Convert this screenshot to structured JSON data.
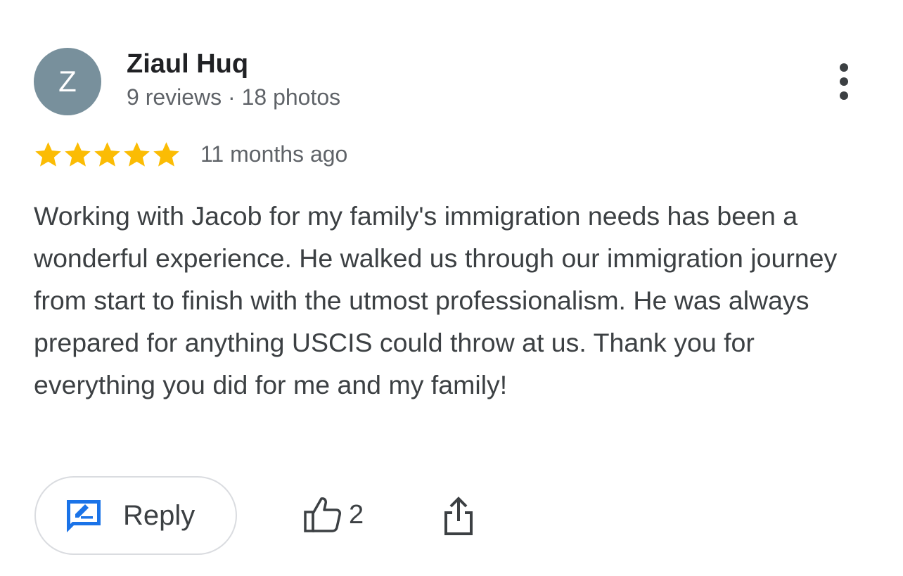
{
  "review": {
    "author": {
      "avatar_letter": "Z",
      "avatar_color": "#78909c",
      "name": "Ziaul Huq",
      "meta": "9 reviews · 18 photos"
    },
    "rating": {
      "stars": 5,
      "max_stars": 5,
      "star_color": "#fbbc04"
    },
    "date": "11 months ago",
    "text": "Working with Jacob for my family's immigration needs has been a wonderful experience. He walked us through our immigration journey from start to finish with the utmost professionalism. He was always prepared for anything USCIS could throw at us. Thank you for everything you did for me and my family!",
    "more_icon": "more-vert-icon"
  },
  "actions": {
    "reply_label": "Reply",
    "reply_icon": "reply-edit-icon",
    "reply_icon_color": "#1a73e8",
    "like_icon": "thumb-up-icon",
    "like_count": "2",
    "share_icon": "share-icon"
  }
}
